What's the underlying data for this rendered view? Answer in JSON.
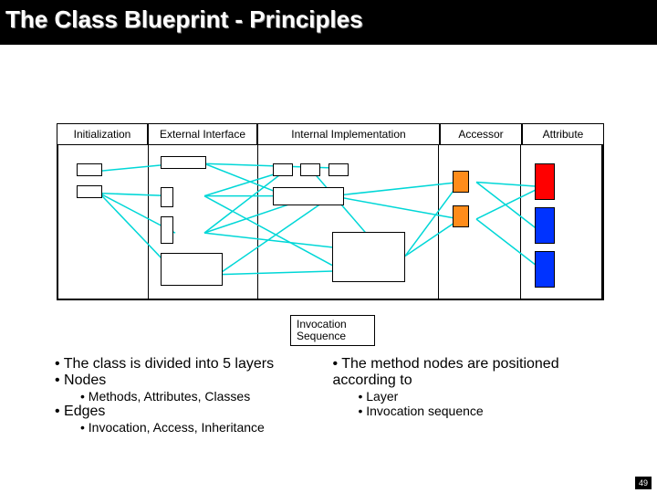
{
  "title": "The Class Blueprint - Principles",
  "layers": {
    "initialization": "Initialization",
    "external": "External Interface",
    "internal": "Internal Implementation",
    "accessor": "Accessor",
    "attribute": "Attribute"
  },
  "invocation_sequence_label": "Invocation\nSequence",
  "bullets": {
    "left": {
      "a": "The class is divided into 5 layers",
      "b": "Nodes",
      "b_sub": "Methods, Attributes, Classes",
      "c": "Edges",
      "c_sub": "Invocation, Access, Inheritance"
    },
    "right": {
      "a": "The method nodes are positioned according to",
      "a_sub1": "Layer",
      "a_sub2": "Invocation sequence"
    }
  },
  "colors": {
    "edge": "#00d7d7",
    "accessor_fill": "#ff8c1a",
    "attr_red": "#ff0000",
    "attr_blue": "#0033ff"
  },
  "page_number": "49"
}
